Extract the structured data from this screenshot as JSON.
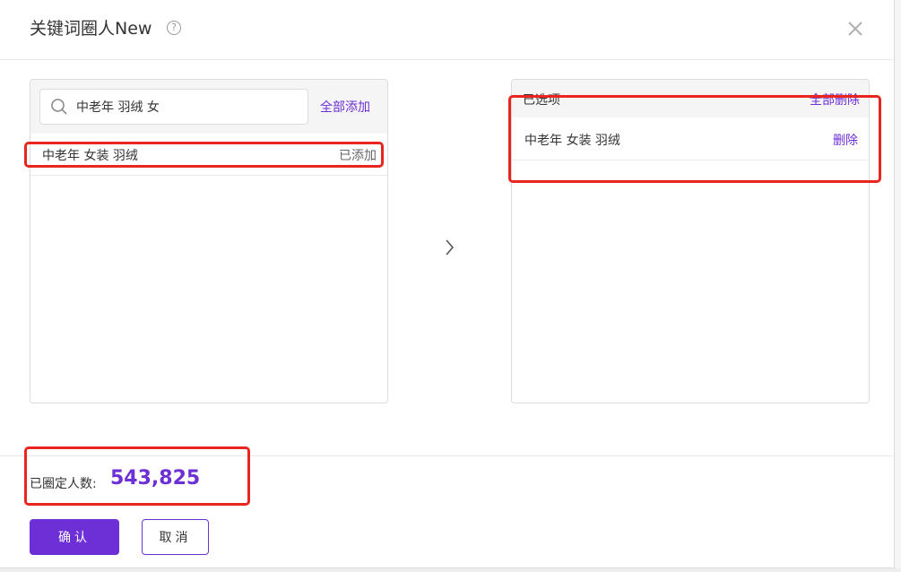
{
  "dialog": {
    "title": "关键词圈人New",
    "help_icon": "question-circle-icon",
    "close_icon": "close-icon"
  },
  "search": {
    "value": "中老年 羽绒 女",
    "placeholder": "",
    "add_all_label": "全部添加"
  },
  "results": [
    {
      "keyword": "中老年 女装 羽绒",
      "status": "已添加"
    }
  ],
  "selected": {
    "header_label": "已选项",
    "delete_all_label": "全部删除",
    "items": [
      {
        "keyword": "中老年 女装 羽绒",
        "delete_label": "删除"
      }
    ]
  },
  "transfer_icon": "chevron-right-icon",
  "summary": {
    "label": "已圈定人数:",
    "value": "543,825"
  },
  "actions": {
    "confirm_label": "确认",
    "cancel_label": "取消"
  },
  "colors": {
    "accent": "#6d2fd6",
    "highlight": "#e8261f"
  }
}
